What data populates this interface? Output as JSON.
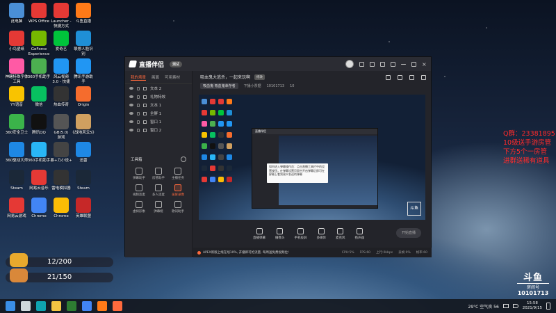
{
  "desktop_icons": [
    {
      "label": "此电脑",
      "color": "#4a8fd6"
    },
    {
      "label": "WPS Office",
      "color": "#e53935"
    },
    {
      "label": "Launcher -\n快捷方式",
      "color": "#e53935"
    },
    {
      "label": "斗鱼直播",
      "color": "#ff7a18"
    },
    {
      "label": "小鸟壁纸",
      "color": "#e53935"
    },
    {
      "label": "GeForce\nExperience",
      "color": "#76b900"
    },
    {
      "label": "爱奇艺",
      "color": "#00c43b"
    },
    {
      "label": "联想人脸识\n别",
      "color": "#1f8fd6"
    },
    {
      "label": "神曙特殊字体\n工具",
      "color": "#ff5aa5"
    },
    {
      "label": "360手机助手",
      "color": "#4caf50"
    },
    {
      "label": "风云视频\n3.0 - 快捷",
      "color": "#2196f3"
    },
    {
      "label": "腾讯手游助\n手",
      "color": "#2196f3"
    },
    {
      "label": "YY语音",
      "color": "#f9c300"
    },
    {
      "label": "微信",
      "color": "#07c160"
    },
    {
      "label": "热血传奇",
      "color": "#333333"
    },
    {
      "label": "Origin",
      "color": "#f56c2d"
    },
    {
      "label": "360安全卫士",
      "color": "#3bb34a"
    },
    {
      "label": "腾讯QQ",
      "color": "#111111"
    },
    {
      "label": "GB(5.0)\n游戏",
      "color": "#555555"
    },
    {
      "label": "《战地风云5》",
      "color": "#d0a060"
    },
    {
      "label": "360驱动大师",
      "color": "#1e88e5"
    },
    {
      "label": "360手机助手",
      "color": "#29b6f6"
    },
    {
      "label": "暴+力小说+",
      "color": "#444444"
    },
    {
      "label": "迅雷",
      "color": "#1e88e5"
    },
    {
      "label": "Steam",
      "color": "#1b2838"
    },
    {
      "label": "网易云音乐",
      "color": "#e53935"
    },
    {
      "label": "雷电模拟器",
      "color": "#333333"
    },
    {
      "label": "Steam",
      "color": "#1b2838"
    },
    {
      "label": "网易云游戏",
      "color": "#e53935"
    },
    {
      "label": "Chrome",
      "color": "#4285f4"
    },
    {
      "label": "Chrome",
      "color": "#fbbc05"
    },
    {
      "label": "英雄联盟",
      "color": "#c62828"
    }
  ],
  "counters": [
    {
      "text": "12/200"
    },
    {
      "text": "21/150"
    }
  ],
  "app": {
    "name": "直播伴侣",
    "version": "测试",
    "tabs": [
      "我的场景",
      "画面",
      "可用素材"
    ],
    "scenes": [
      "文本 2",
      "礼物特效",
      "文本 1",
      "全屏 1",
      "窗口 1",
      "窗口 2"
    ],
    "tools_title": "工具箱",
    "tools": [
      {
        "label": "弹幕助手",
        "hot": false
      },
      {
        "label": "房管助手",
        "hot": false
      },
      {
        "label": "主播任务",
        "hot": false
      },
      {
        "label": "视频连麦",
        "hot": false
      },
      {
        "label": "多人连麦",
        "hot": false
      },
      {
        "label": "录屏录像",
        "hot": true
      },
      {
        "label": "虚拟形象",
        "hot": false
      },
      {
        "label": "弹幕姬",
        "hot": false
      },
      {
        "label": "歌词助手",
        "hot": false
      }
    ],
    "room_title": "吸血鬼大逃杀，一起来玩啊",
    "edit_label": "修改",
    "category": "吸血鬼·吸血鬼幸存者",
    "area": "下播小票据",
    "room_id": "10101713",
    "follows": "10",
    "start_label": "开始直播",
    "bottom_actions": [
      "直播弹幕",
      "摄像头",
      "手机投屏",
      "多媒体",
      "麦克风",
      "扬声器"
    ],
    "notice": "APEX新版上线在线10%,  开播即可抢流量,  每周送免费视频位!",
    "status": [
      "CPU:5%",
      "FPS:60",
      "上行:0kbps",
      "丢帧:0%",
      "帧率:60"
    ],
    "tip_text": "如何进入弹幕操作员：点击直播工具栏中的设置按钮，在弹幕设置页面中开启弹幕后即可在屏幕上看到观众发送的弹幕",
    "preview_logo": "斗鱼"
  },
  "overlay_text": [
    "Q群：23381895",
    "10级送手游房管",
    "下方5个一房管",
    "进群送稀有道具"
  ],
  "douyu": {
    "brand": "斗鱼",
    "room_label": "房间号",
    "room_number": "10101713"
  },
  "taskbar": {
    "weather": "29°C 空气良 56",
    "time": "15:58",
    "date": "2021/9/15",
    "icons": [
      {
        "name": "start",
        "color": "#3a8ee6"
      },
      {
        "name": "search",
        "color": "#cfd8dc"
      },
      {
        "name": "edge",
        "color": "#0fa3b1"
      },
      {
        "name": "files",
        "color": "#f4c542"
      },
      {
        "name": "store",
        "color": "#2e7d32"
      },
      {
        "name": "chrome",
        "color": "#4285f4"
      },
      {
        "name": "app-orange",
        "color": "#ff7a18"
      },
      {
        "name": "app-orange-2",
        "color": "#ff6a3d"
      }
    ]
  }
}
